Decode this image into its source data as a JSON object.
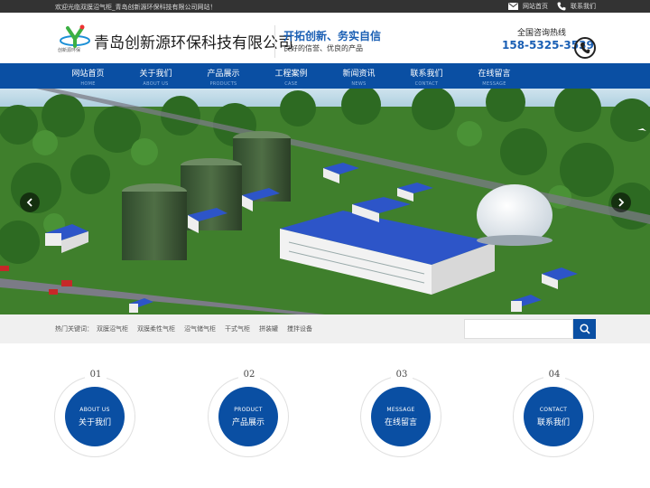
{
  "topbar": {
    "welcome": "欢迎光临双膜沼气柜_青岛创新源环保科技有限公司网站！",
    "links": [
      {
        "label": "网站首页",
        "icon": "mail-icon"
      },
      {
        "label": "联系我们",
        "icon": "phone-icon"
      }
    ]
  },
  "header": {
    "logo_caption": "创新源环保",
    "company_name": "青岛创新源环保科技有限公司",
    "slogan_main": "开拓创新、务实自信",
    "slogan_sub": "良好的信誉、优良的产品",
    "hotline_label": "全国咨询热线",
    "hotline_number": "158-5325-3539"
  },
  "nav": {
    "items": [
      {
        "cn": "网站首页",
        "en": "HOME"
      },
      {
        "cn": "关于我们",
        "en": "ABOUT US"
      },
      {
        "cn": "产品展示",
        "en": "PRODUCTS"
      },
      {
        "cn": "工程案例",
        "en": "CASE"
      },
      {
        "cn": "新闻资讯",
        "en": "NEWS"
      },
      {
        "cn": "联系我们",
        "en": "CONTACT"
      },
      {
        "cn": "在线留言",
        "en": "MESSAGE"
      }
    ]
  },
  "search": {
    "hot_label": "热门关键词：",
    "keywords": [
      "双膜沼气柜",
      "双膜柔性气柜",
      "沼气储气柜",
      "干式气柜",
      "拼装罐",
      "搅拌设备"
    ],
    "placeholder": ""
  },
  "features": [
    {
      "num": "01",
      "en": "ABOUT US",
      "cn": "关于我们"
    },
    {
      "num": "02",
      "en": "PRODUCT",
      "cn": "产品展示"
    },
    {
      "num": "03",
      "en": "MESSAGE",
      "cn": "在线留言"
    },
    {
      "num": "04",
      "en": "CONTACT",
      "cn": "联系我们"
    }
  ],
  "colors": {
    "primary": "#0a4fa3",
    "topbar": "#333333",
    "accent_text": "#1a5fb4"
  }
}
